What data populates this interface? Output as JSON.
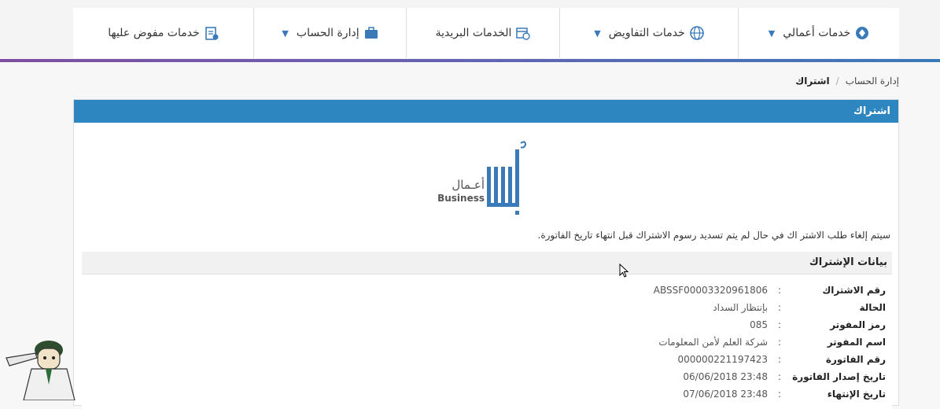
{
  "nav": {
    "items": [
      {
        "label": "خدمات أعمالي",
        "icon": "business-services-icon",
        "has_caret": true
      },
      {
        "label": "خدمات التفاويض",
        "icon": "globe-icon",
        "has_caret": true
      },
      {
        "label": "الخدمات البريدية",
        "icon": "calendar-clock-icon",
        "has_caret": false
      },
      {
        "label": "إدارة الحساب",
        "icon": "briefcase-icon",
        "has_caret": true
      },
      {
        "label": "خدمات مفوض عليها",
        "icon": "clipboard-check-icon",
        "has_caret": false
      }
    ]
  },
  "breadcrumb": {
    "parent": "إدارة الحساب",
    "separator": "/",
    "current": "اشتراك"
  },
  "panel": {
    "title": "اشتراك",
    "logo": {
      "arabic": "أعـمال",
      "english": "Business"
    },
    "notice": "سيتم إلغاء طلب الاشتر اك في حال لم يتم تسديد رسوم الاشتراك قبل انتهاء تاريخ الفاتورة."
  },
  "subscription": {
    "title": "بيانات الإشتراك",
    "rows": [
      {
        "label": "رقم الاشتراك",
        "value": "ABSSF00003320961806"
      },
      {
        "label": "الحالة",
        "value": "بإنتظار السداد"
      },
      {
        "label": "رمز المفوتر",
        "value": "085"
      },
      {
        "label": "اسم المفوتر",
        "value": "شركة العلم لأمن المعلومات"
      },
      {
        "label": "رقم الفاتورة",
        "value": "000000221197423"
      },
      {
        "label": "تاريخ إصدار الفاتورة",
        "value": "23:48 06/06/2018"
      },
      {
        "label": "تاريخ الإنتهاء",
        "value": "23:48 07/06/2018"
      }
    ],
    "colon": ":"
  },
  "colors": {
    "primary": "#2e86c1",
    "accent_purple": "#7e4fa0"
  }
}
